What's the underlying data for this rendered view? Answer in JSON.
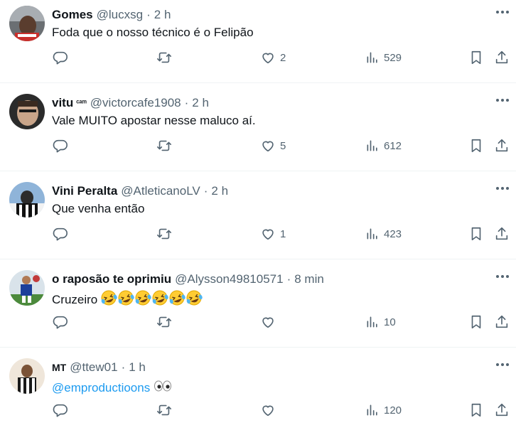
{
  "tweets": [
    {
      "name": "Gomes",
      "badge": "",
      "handle": "@lucxsg",
      "dot": "·",
      "time": "2 h",
      "text": "Foda que o nosso técnico é o Felipão",
      "replies": "",
      "retweets": "",
      "likes": "2",
      "views": "529"
    },
    {
      "name": "vitu",
      "badge": "ᶜᵃᵐ",
      "handle": "@victorcafe1908",
      "dot": "·",
      "time": "2 h",
      "text": "Vale MUITO apostar nesse maluco aí.",
      "replies": "",
      "retweets": "",
      "likes": "5",
      "views": "612"
    },
    {
      "name": "Vini Peralta",
      "badge": "",
      "handle": "@AtleticanoLV",
      "dot": "·",
      "time": "2 h",
      "text": "Que venha então",
      "replies": "",
      "retweets": "",
      "likes": "1",
      "views": "423"
    },
    {
      "name": "o raposão te oprimiu",
      "badge": "",
      "handle": "@Alysson49810571",
      "dot": "·",
      "time": "8 min",
      "text": "Cruzeiro",
      "emojis": [
        "🤣",
        "🤣",
        "🤣",
        "🤣",
        "🤣",
        "🤣"
      ],
      "replies": "",
      "retweets": "",
      "likes": "",
      "views": "10"
    },
    {
      "name": "MT",
      "badge": "",
      "handle": "@ttew01",
      "dot": "·",
      "time": "1 h",
      "mention": "@emproductioons",
      "text": "",
      "emojis": [
        "👀"
      ],
      "replies": "",
      "retweets": "",
      "likes": "",
      "views": "120"
    }
  ],
  "icons": {
    "reply": "reply-icon",
    "retweet": "retweet-icon",
    "like": "heart-icon",
    "views": "views-icon",
    "bookmark": "bookmark-icon",
    "share": "share-icon",
    "more": "more-icon"
  },
  "colors": {
    "text": "#0f1419",
    "secondary": "#536471",
    "link": "#1d9bf0",
    "divider": "#eff3f4"
  }
}
